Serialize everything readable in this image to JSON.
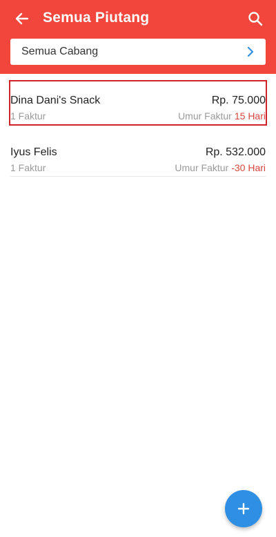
{
  "appbar": {
    "title": "Semua Piutang",
    "back_icon": "arrow-left-icon",
    "search_icon": "search-icon"
  },
  "branch_filter": {
    "label": "Semua Cabang",
    "icon": "chevron-right-icon"
  },
  "receivables": [
    {
      "name": "Dina Dani's Snack",
      "amount": "Rp. 75.000",
      "invoice_count": "1 Faktur",
      "age_label": "Umur Faktur",
      "age_value": "15 Hari",
      "selected": true
    },
    {
      "name": "Iyus Felis",
      "amount": "Rp. 532.000",
      "invoice_count": "1 Faktur",
      "age_label": "Umur Faktur",
      "age_value": "-30 Hari",
      "selected": false
    }
  ],
  "fab": {
    "icon": "plus-icon"
  },
  "colors": {
    "header": "#f2453c",
    "accent_blue": "#2f8fe3",
    "age_red": "#d9453c",
    "selection_border": "#d0222a"
  }
}
